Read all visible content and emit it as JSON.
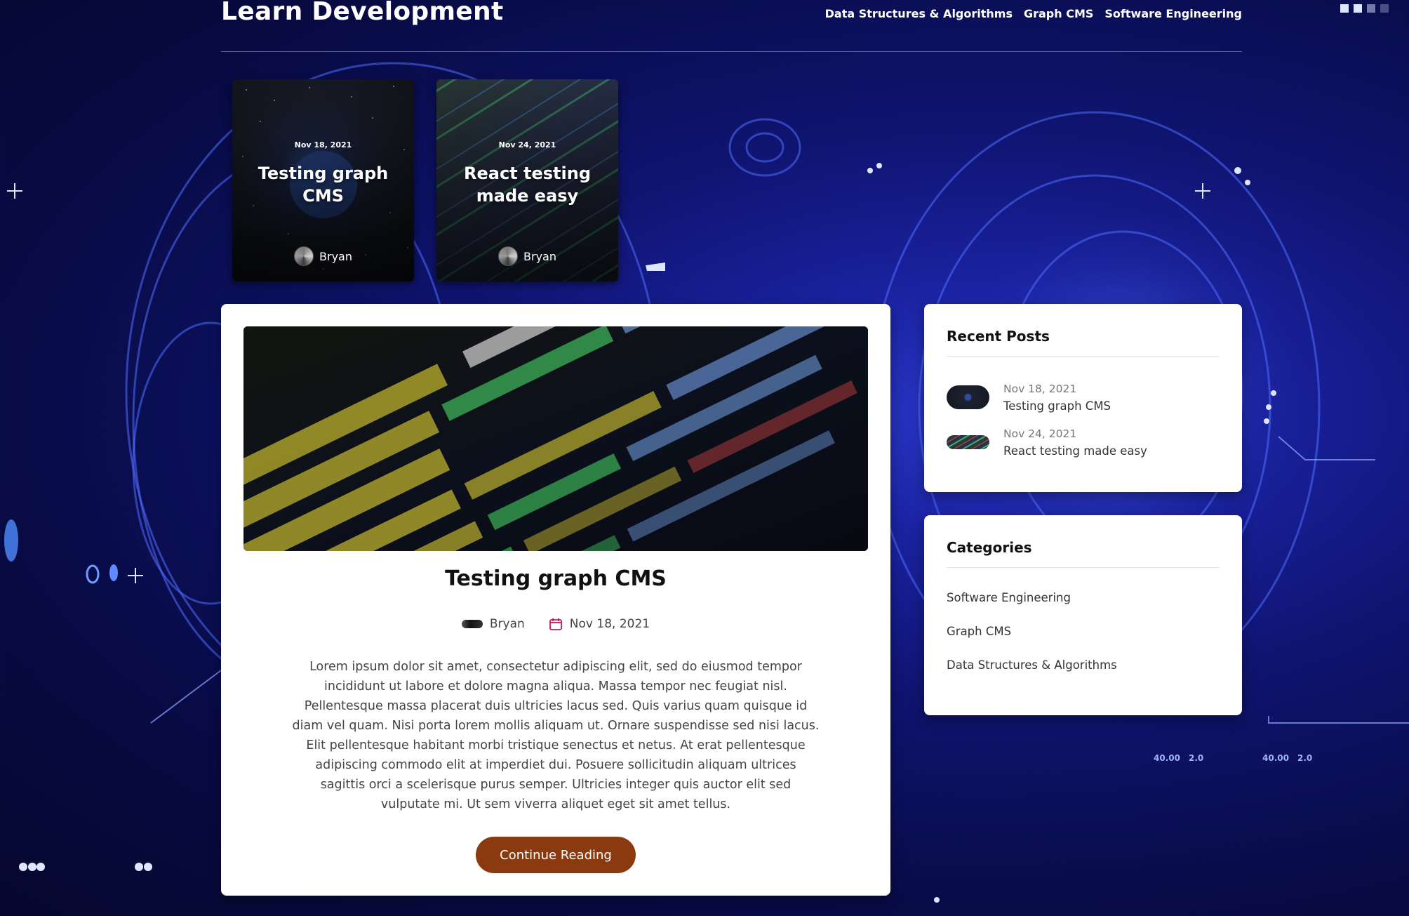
{
  "site": {
    "title": "Learn Development"
  },
  "nav": {
    "items": [
      {
        "label": "Data Structures & Algorithms"
      },
      {
        "label": "Graph CMS"
      },
      {
        "label": "Software Engineering"
      }
    ]
  },
  "featured": [
    {
      "date": "Nov 18, 2021",
      "title": "Testing graph CMS",
      "author": "Bryan"
    },
    {
      "date": "Nov 24, 2021",
      "title": "React testing made easy",
      "author": "Bryan"
    }
  ],
  "post": {
    "title": "Testing graph CMS",
    "author": "Bryan",
    "date": "Nov 18, 2021",
    "excerpt": "Lorem ipsum dolor sit amet, consectetur adipiscing elit, sed do eiusmod tempor incididunt ut labore et dolore magna aliqua. Massa tempor nec feugiat nisl. Pellentesque massa placerat duis ultricies lacus sed. Quis varius quam quisque id diam vel quam. Nisi porta lorem mollis aliquam ut. Ornare suspendisse sed nisi lacus. Elit pellentesque habitant morbi tristique senectus et netus. At erat pellentesque adipiscing commodo elit at imperdiet dui. Posuere sollicitudin aliquam ultrices sagittis orci a scelerisque purus semper. Ultricies integer quis auctor elit sed vulputate mi. Ut sem viverra aliquet eget sit amet tellus.",
    "button_label": "Continue Reading"
  },
  "recent_posts": {
    "heading": "Recent Posts",
    "items": [
      {
        "date": "Nov 18, 2021",
        "title": "Testing graph CMS"
      },
      {
        "date": "Nov 24, 2021",
        "title": "React testing made easy"
      }
    ]
  },
  "categories": {
    "heading": "Categories",
    "items": [
      {
        "label": "Software Engineering"
      },
      {
        "label": "Graph CMS"
      },
      {
        "label": "Data Structures & Algorithms"
      }
    ]
  },
  "colors": {
    "button": "#8b3a0f",
    "calendar_icon": "#c2185b",
    "header_rule": "#4b62d8"
  },
  "icons": {
    "calendar": "calendar-icon",
    "author": "avatar"
  }
}
